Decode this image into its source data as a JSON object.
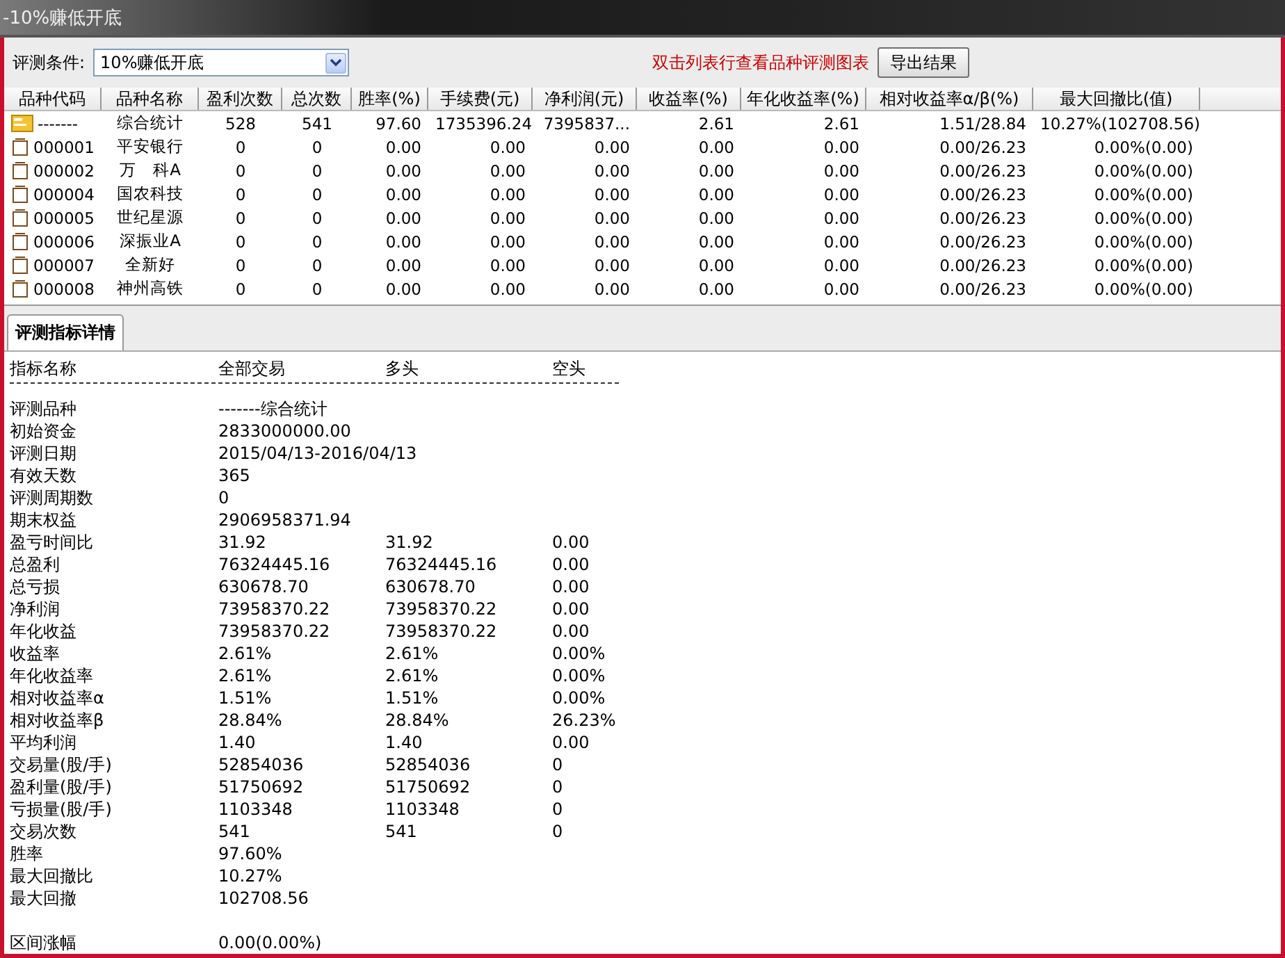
{
  "window": {
    "title": "-10%赚低开底"
  },
  "toolbar": {
    "condition_label": "评测条件:",
    "condition_value": "10%赚低开底",
    "hint": "双击列表行查看品种评测图表",
    "export_button": "导出结果"
  },
  "table": {
    "columns": [
      "品种代码",
      "品种名称",
      "盈利次数",
      "总次数",
      "胜率(%)",
      "手续费(元)",
      "净利润(元)",
      "收益率(%)",
      "年化收益率(%)",
      "相对收益率α/β(%)",
      "最大回撤比(值)"
    ],
    "rows": [
      {
        "kind": "summary",
        "cells": [
          "-------",
          "综合统计",
          "528",
          "541",
          "97.60",
          "1735396.24",
          "7395837...",
          "2.61",
          "2.61",
          "1.51/28.84",
          "10.27%(102708.56)"
        ]
      },
      {
        "kind": "stock",
        "cells": [
          "000001",
          "平安银行",
          "0",
          "0",
          "0.00",
          "0.00",
          "0.00",
          "0.00",
          "0.00",
          "0.00/26.23",
          "0.00%(0.00)"
        ]
      },
      {
        "kind": "stock",
        "cells": [
          "000002",
          "万　科A",
          "0",
          "0",
          "0.00",
          "0.00",
          "0.00",
          "0.00",
          "0.00",
          "0.00/26.23",
          "0.00%(0.00)"
        ]
      },
      {
        "kind": "stock",
        "cells": [
          "000004",
          "国农科技",
          "0",
          "0",
          "0.00",
          "0.00",
          "0.00",
          "0.00",
          "0.00",
          "0.00/26.23",
          "0.00%(0.00)"
        ]
      },
      {
        "kind": "stock",
        "cells": [
          "000005",
          "世纪星源",
          "0",
          "0",
          "0.00",
          "0.00",
          "0.00",
          "0.00",
          "0.00",
          "0.00/26.23",
          "0.00%(0.00)"
        ]
      },
      {
        "kind": "stock",
        "cells": [
          "000006",
          "深振业A",
          "0",
          "0",
          "0.00",
          "0.00",
          "0.00",
          "0.00",
          "0.00",
          "0.00/26.23",
          "0.00%(0.00)"
        ]
      },
      {
        "kind": "stock",
        "cells": [
          "000007",
          "全新好",
          "0",
          "0",
          "0.00",
          "0.00",
          "0.00",
          "0.00",
          "0.00",
          "0.00/26.23",
          "0.00%(0.00)"
        ]
      },
      {
        "kind": "stock",
        "cells": [
          "000008",
          "神州高铁",
          "0",
          "0",
          "0.00",
          "0.00",
          "0.00",
          "0.00",
          "0.00",
          "0.00/26.23",
          "0.00%(0.00)"
        ]
      }
    ]
  },
  "tabs": [
    {
      "label": "评测指标详情",
      "selected": true
    }
  ],
  "details": {
    "columns": [
      "指标名称",
      "全部交易",
      "多头",
      "空头"
    ],
    "rows": [
      {
        "label": "评测品种",
        "values": [
          "-------综合统计"
        ]
      },
      {
        "label": "初始资金",
        "values": [
          "2833000000.00"
        ]
      },
      {
        "label": "评测日期",
        "values": [
          "2015/04/13-2016/04/13"
        ]
      },
      {
        "label": "有效天数",
        "values": [
          "365"
        ]
      },
      {
        "label": "评测周期数",
        "values": [
          "0"
        ]
      },
      {
        "label": "期末权益",
        "values": [
          "2906958371.94"
        ]
      },
      {
        "label": "盈亏时间比",
        "values": [
          "31.92",
          "31.92",
          "0.00"
        ]
      },
      {
        "label": "总盈利",
        "values": [
          "76324445.16",
          "76324445.16",
          "0.00"
        ]
      },
      {
        "label": "总亏损",
        "values": [
          "630678.70",
          "630678.70",
          "0.00"
        ]
      },
      {
        "label": "净利润",
        "values": [
          "73958370.22",
          "73958370.22",
          "0.00"
        ]
      },
      {
        "label": "年化收益",
        "values": [
          "73958370.22",
          "73958370.22",
          "0.00"
        ]
      },
      {
        "label": "收益率",
        "values": [
          "2.61%",
          "2.61%",
          "0.00%"
        ]
      },
      {
        "label": "年化收益率",
        "values": [
          "2.61%",
          "2.61%",
          "0.00%"
        ]
      },
      {
        "label": "相对收益率α",
        "values": [
          "1.51%",
          "1.51%",
          "0.00%"
        ]
      },
      {
        "label": "相对收益率β",
        "values": [
          "28.84%",
          "28.84%",
          "26.23%"
        ]
      },
      {
        "label": "平均利润",
        "values": [
          "1.40",
          "1.40",
          "0.00"
        ]
      },
      {
        "label": "交易量(股/手)",
        "values": [
          "52854036",
          "52854036",
          "0"
        ]
      },
      {
        "label": "盈利量(股/手)",
        "values": [
          "51750692",
          "51750692",
          "0"
        ]
      },
      {
        "label": "亏损量(股/手)",
        "values": [
          "1103348",
          "1103348",
          "0"
        ]
      },
      {
        "label": "交易次数",
        "values": [
          "541",
          "541",
          "0"
        ]
      },
      {
        "label": "胜率",
        "values": [
          "97.60%"
        ]
      },
      {
        "label": "最大回撤比",
        "values": [
          "10.27%"
        ]
      },
      {
        "label": "最大回撤",
        "values": [
          "102708.56"
        ]
      },
      {
        "label": "区间涨幅",
        "values": [
          "0.00(0.00%)"
        ],
        "gap_before": true
      }
    ]
  }
}
